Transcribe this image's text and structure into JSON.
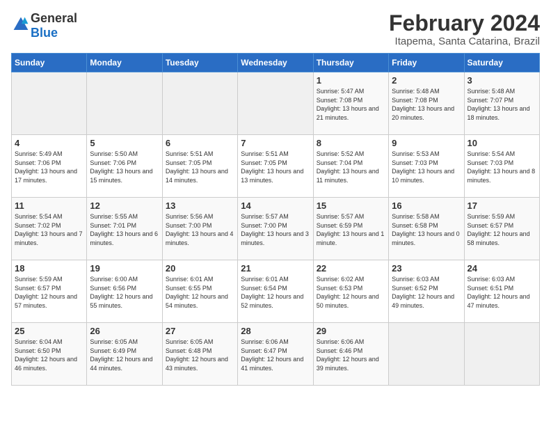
{
  "header": {
    "logo_general": "General",
    "logo_blue": "Blue",
    "title": "February 2024",
    "subtitle": "Itapema, Santa Catarina, Brazil"
  },
  "days_of_week": [
    "Sunday",
    "Monday",
    "Tuesday",
    "Wednesday",
    "Thursday",
    "Friday",
    "Saturday"
  ],
  "weeks": [
    [
      {
        "day": "",
        "info": ""
      },
      {
        "day": "",
        "info": ""
      },
      {
        "day": "",
        "info": ""
      },
      {
        "day": "",
        "info": ""
      },
      {
        "day": "1",
        "info": "Sunrise: 5:47 AM\nSunset: 7:08 PM\nDaylight: 13 hours\nand 21 minutes."
      },
      {
        "day": "2",
        "info": "Sunrise: 5:48 AM\nSunset: 7:08 PM\nDaylight: 13 hours\nand 20 minutes."
      },
      {
        "day": "3",
        "info": "Sunrise: 5:48 AM\nSunset: 7:07 PM\nDaylight: 13 hours\nand 18 minutes."
      }
    ],
    [
      {
        "day": "4",
        "info": "Sunrise: 5:49 AM\nSunset: 7:06 PM\nDaylight: 13 hours\nand 17 minutes."
      },
      {
        "day": "5",
        "info": "Sunrise: 5:50 AM\nSunset: 7:06 PM\nDaylight: 13 hours\nand 15 minutes."
      },
      {
        "day": "6",
        "info": "Sunrise: 5:51 AM\nSunset: 7:05 PM\nDaylight: 13 hours\nand 14 minutes."
      },
      {
        "day": "7",
        "info": "Sunrise: 5:51 AM\nSunset: 7:05 PM\nDaylight: 13 hours\nand 13 minutes."
      },
      {
        "day": "8",
        "info": "Sunrise: 5:52 AM\nSunset: 7:04 PM\nDaylight: 13 hours\nand 11 minutes."
      },
      {
        "day": "9",
        "info": "Sunrise: 5:53 AM\nSunset: 7:03 PM\nDaylight: 13 hours\nand 10 minutes."
      },
      {
        "day": "10",
        "info": "Sunrise: 5:54 AM\nSunset: 7:03 PM\nDaylight: 13 hours\nand 8 minutes."
      }
    ],
    [
      {
        "day": "11",
        "info": "Sunrise: 5:54 AM\nSunset: 7:02 PM\nDaylight: 13 hours\nand 7 minutes."
      },
      {
        "day": "12",
        "info": "Sunrise: 5:55 AM\nSunset: 7:01 PM\nDaylight: 13 hours\nand 6 minutes."
      },
      {
        "day": "13",
        "info": "Sunrise: 5:56 AM\nSunset: 7:00 PM\nDaylight: 13 hours\nand 4 minutes."
      },
      {
        "day": "14",
        "info": "Sunrise: 5:57 AM\nSunset: 7:00 PM\nDaylight: 13 hours\nand 3 minutes."
      },
      {
        "day": "15",
        "info": "Sunrise: 5:57 AM\nSunset: 6:59 PM\nDaylight: 13 hours\nand 1 minute."
      },
      {
        "day": "16",
        "info": "Sunrise: 5:58 AM\nSunset: 6:58 PM\nDaylight: 13 hours\nand 0 minutes."
      },
      {
        "day": "17",
        "info": "Sunrise: 5:59 AM\nSunset: 6:57 PM\nDaylight: 12 hours\nand 58 minutes."
      }
    ],
    [
      {
        "day": "18",
        "info": "Sunrise: 5:59 AM\nSunset: 6:57 PM\nDaylight: 12 hours\nand 57 minutes."
      },
      {
        "day": "19",
        "info": "Sunrise: 6:00 AM\nSunset: 6:56 PM\nDaylight: 12 hours\nand 55 minutes."
      },
      {
        "day": "20",
        "info": "Sunrise: 6:01 AM\nSunset: 6:55 PM\nDaylight: 12 hours\nand 54 minutes."
      },
      {
        "day": "21",
        "info": "Sunrise: 6:01 AM\nSunset: 6:54 PM\nDaylight: 12 hours\nand 52 minutes."
      },
      {
        "day": "22",
        "info": "Sunrise: 6:02 AM\nSunset: 6:53 PM\nDaylight: 12 hours\nand 50 minutes."
      },
      {
        "day": "23",
        "info": "Sunrise: 6:03 AM\nSunset: 6:52 PM\nDaylight: 12 hours\nand 49 minutes."
      },
      {
        "day": "24",
        "info": "Sunrise: 6:03 AM\nSunset: 6:51 PM\nDaylight: 12 hours\nand 47 minutes."
      }
    ],
    [
      {
        "day": "25",
        "info": "Sunrise: 6:04 AM\nSunset: 6:50 PM\nDaylight: 12 hours\nand 46 minutes."
      },
      {
        "day": "26",
        "info": "Sunrise: 6:05 AM\nSunset: 6:49 PM\nDaylight: 12 hours\nand 44 minutes."
      },
      {
        "day": "27",
        "info": "Sunrise: 6:05 AM\nSunset: 6:48 PM\nDaylight: 12 hours\nand 43 minutes."
      },
      {
        "day": "28",
        "info": "Sunrise: 6:06 AM\nSunset: 6:47 PM\nDaylight: 12 hours\nand 41 minutes."
      },
      {
        "day": "29",
        "info": "Sunrise: 6:06 AM\nSunset: 6:46 PM\nDaylight: 12 hours\nand 39 minutes."
      },
      {
        "day": "",
        "info": ""
      },
      {
        "day": "",
        "info": ""
      }
    ]
  ]
}
